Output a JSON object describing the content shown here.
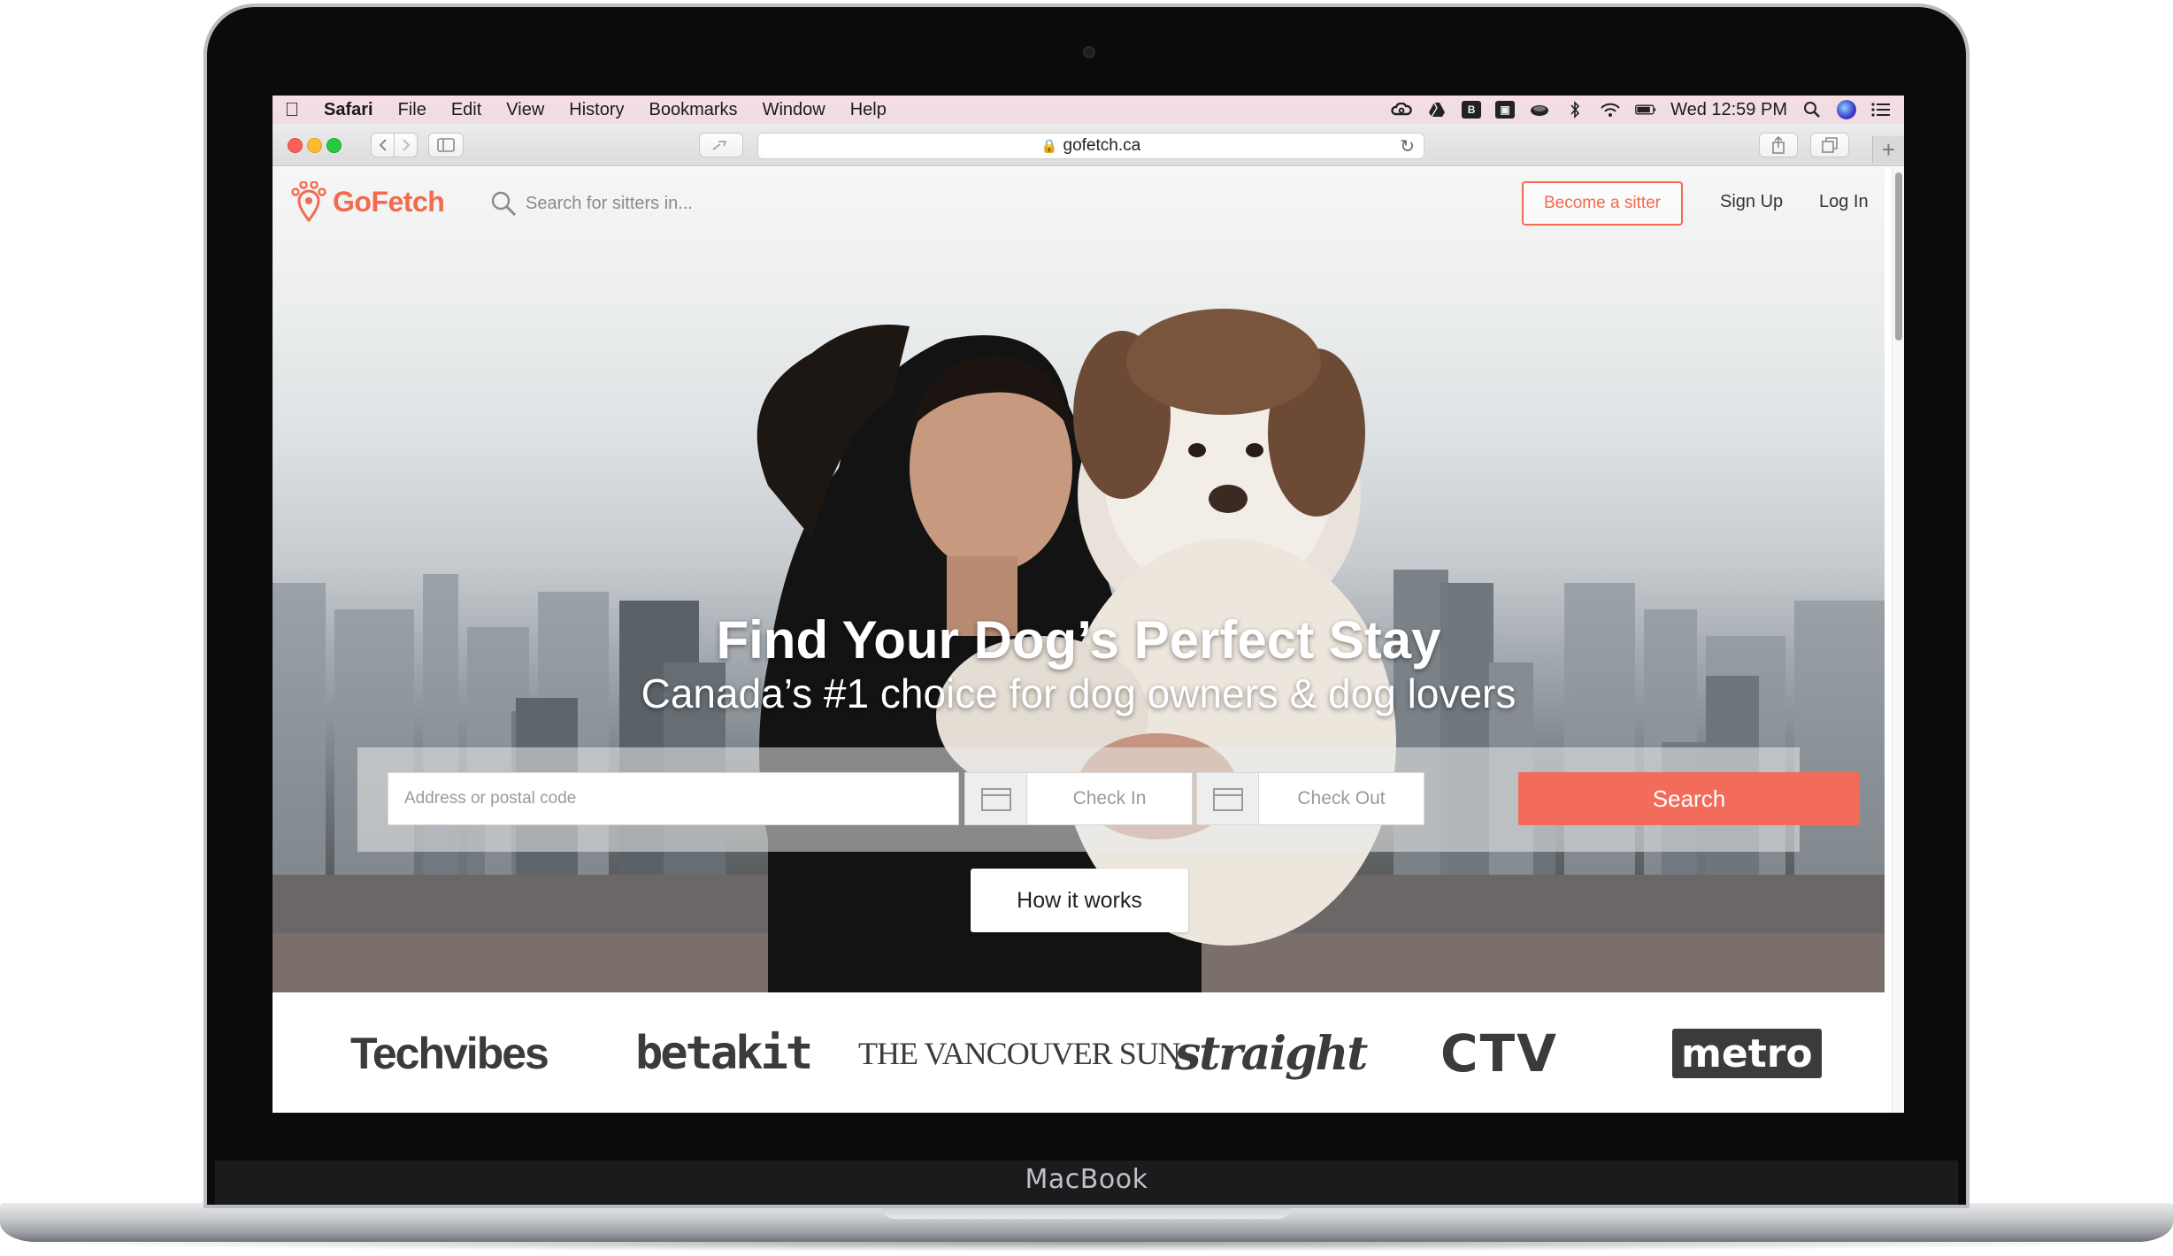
{
  "device": {
    "label": "MacBook"
  },
  "menubar": {
    "app": "Safari",
    "items": [
      "File",
      "Edit",
      "View",
      "History",
      "Bookmarks",
      "Window",
      "Help"
    ],
    "clock": "Wed 12:59 PM",
    "status_icons": [
      "creative-cloud-icon",
      "google-drive-icon",
      "app-box-icon",
      "app-box-2-icon",
      "cloud-icon",
      "bluetooth-icon",
      "wifi-icon",
      "battery-icon",
      "spotlight-icon",
      "siri-icon",
      "notification-center-icon"
    ]
  },
  "browser": {
    "url": "gofetch.ca",
    "new_tab_symbol": "+"
  },
  "site": {
    "logo_text": "GoFetch",
    "brand_color": "#f26b4f",
    "search_placeholder": "Search for sitters in...",
    "become_sitter": "Become a sitter",
    "sign_up": "Sign Up",
    "log_in": "Log In"
  },
  "hero": {
    "headline": "Find Your Dog’s Perfect Stay",
    "subheadline": "Canada’s #1 choice for dog owners & dog lovers",
    "address_placeholder": "Address or postal code",
    "check_in": "Check In",
    "check_out": "Check Out",
    "search_button": "Search",
    "how_it_works": "How it works"
  },
  "press": {
    "logos": [
      "Techvibes",
      "betakit",
      "THE VANCOUVER SUN",
      "straight",
      "CTV",
      "metro"
    ]
  }
}
